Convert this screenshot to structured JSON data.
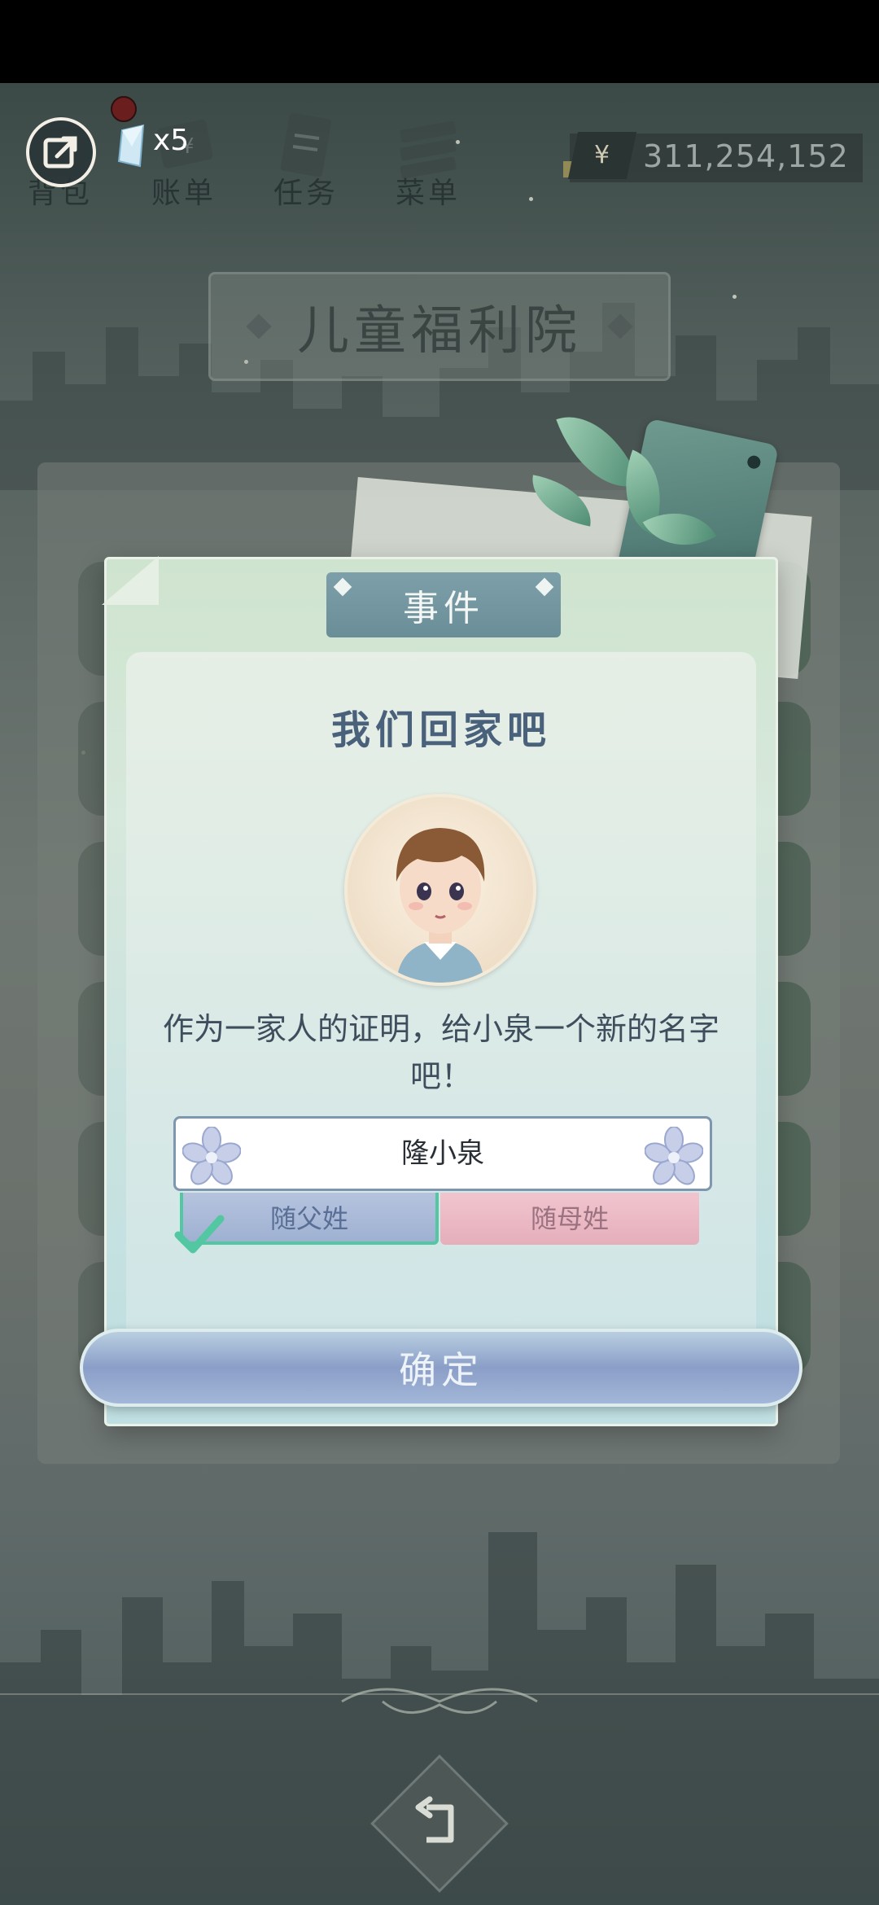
{
  "top_bar": {
    "tabs": [
      {
        "label": "背包",
        "icon": "bag-icon"
      },
      {
        "label": "账单",
        "icon": "bill-icon"
      },
      {
        "label": "任务",
        "icon": "task-icon"
      },
      {
        "label": "菜单",
        "icon": "menu-icon"
      }
    ],
    "gem_count": "x5",
    "currency_symbol": "¥",
    "money": "311,254,152"
  },
  "location": {
    "title": "儿童福利院"
  },
  "dialog": {
    "header": "事件",
    "title": "我们回家吧",
    "description": "作为一家人的证明，给小泉一个新的名字吧！",
    "name_value": "隆小泉",
    "surname_options": [
      {
        "label": "随父姓",
        "selected": true
      },
      {
        "label": "随母姓",
        "selected": false
      }
    ],
    "confirm_label": "确定"
  },
  "colors": {
    "accent_check": "#53c6a2",
    "title_text": "#4a617b",
    "father_option": "#aebcdb",
    "mother_option": "#ecbac6"
  }
}
